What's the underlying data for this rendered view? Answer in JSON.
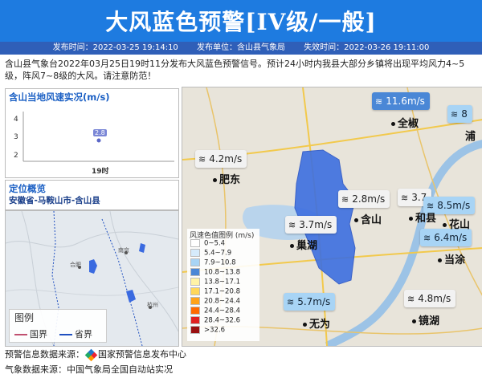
{
  "header": {
    "title": "大风蓝色预警[IV级/一般]",
    "publish_time": "发布时间：2022-03-25 19:14:10",
    "publisher": "发布单位：含山县气象局",
    "expire_time": "失效时间：2022-03-26 19:11:00"
  },
  "description": "含山县气象台2022年03月25日19时11分发布大风蓝色预警信号。预计24小时内我县大部分乡镇将出现平均风力4~5级，阵风7~8级的大风。请注意防范！",
  "wind_panel": {
    "title": "含山当地风速实况(m/s)",
    "chart_data": {
      "type": "scatter",
      "x": [
        "19时"
      ],
      "values": [
        2.8
      ],
      "ylim": [
        2,
        4
      ],
      "yticks": [
        "4",
        "3",
        "2"
      ],
      "data_labels": [
        "2.8"
      ]
    }
  },
  "location": {
    "title": "定位概览",
    "path": "安徽省-马鞍山市-含山县"
  },
  "mini_map": {
    "cities": [
      "南京",
      "合肥",
      "杭州"
    ],
    "legend": {
      "title": "图例",
      "items": [
        {
          "label": "国界",
          "color": "#c05070"
        },
        {
          "label": "省界",
          "color": "#2050c0"
        }
      ]
    }
  },
  "main_map": {
    "color_legend": {
      "title": "风速色值图例 (m/s)",
      "items": [
        {
          "label": "0~5.4",
          "color": "#ffffff"
        },
        {
          "label": "5.4~7.9",
          "color": "#d6ebfb"
        },
        {
          "label": "7.9~10.8",
          "color": "#a8d4f5"
        },
        {
          "label": "10.8~13.8",
          "color": "#4a87d6"
        },
        {
          "label": "13.8~17.1",
          "color": "#fff3a6"
        },
        {
          "label": "17.1~20.8",
          "color": "#ffd75a"
        },
        {
          "label": "20.8~24.4",
          "color": "#ffa31a"
        },
        {
          "label": "24.4~28.4",
          "color": "#ff6a00"
        },
        {
          "label": "28.4~32.6",
          "color": "#e02020"
        },
        {
          "label": ">32.6",
          "color": "#9a1010"
        }
      ]
    },
    "wind_labels": [
      {
        "id": "quanjiao",
        "value": "11.6m/s",
        "style": "dark"
      },
      {
        "id": "hefei",
        "value": "4.2m/s",
        "style": "white"
      },
      {
        "id": "hanshan",
        "value": "2.8m/s",
        "style": "white"
      },
      {
        "id": "hexian-a",
        "value": "3.7",
        "style": "white"
      },
      {
        "id": "hexian-b",
        "value": "8.5m/s",
        "style": "blue"
      },
      {
        "id": "huashan",
        "value": "6.4m/s",
        "style": "blue"
      },
      {
        "id": "chaohu",
        "value": "3.7m/s",
        "style": "white"
      },
      {
        "id": "wuwei",
        "value": "5.7m/s",
        "style": "blue"
      },
      {
        "id": "jinghu",
        "value": "4.8m/s",
        "style": "white"
      },
      {
        "id": "pukou",
        "value": "8",
        "style": "blue"
      }
    ],
    "cities": [
      "全椒",
      "浦",
      "肥东",
      "含山",
      "和县",
      "花山",
      "巢湖",
      "当涂",
      "无为",
      "镜湖"
    ]
  },
  "footer": {
    "warning_source_label": "预警信息数据来源：",
    "warning_source": "国家预警信息发布中心",
    "weather_source": "气象数据来源：中国气象局全国自动站实况"
  }
}
